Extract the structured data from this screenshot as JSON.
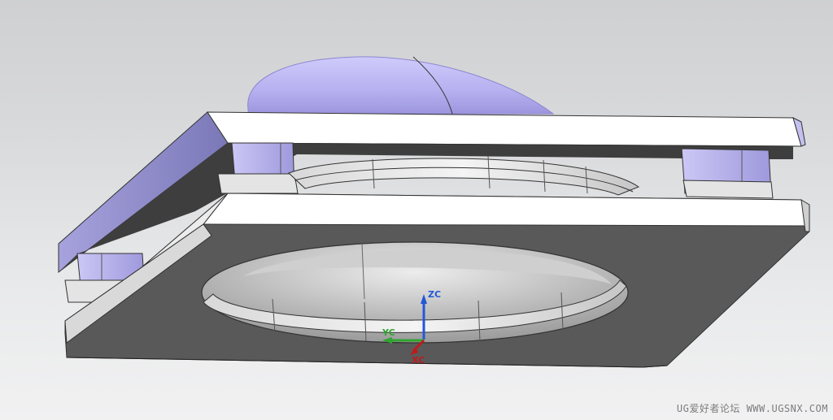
{
  "viewport": {
    "background_top": "#cfd0d2",
    "background_bottom": "#f1f1f2",
    "model": {
      "body_color": "#5a5a5a",
      "plate_top_color": "#ffffff",
      "shade_color": "#b9b4ee",
      "edge_color": "#333333"
    }
  },
  "triad": {
    "x_label": "XC",
    "y_label": "YC",
    "z_label": "ZC",
    "x_color": "#c0191b",
    "y_color": "#2fa52f",
    "z_color": "#2357d6"
  },
  "watermark": {
    "text": "UG爱好者论坛 WWW.UGSNX.COM"
  }
}
